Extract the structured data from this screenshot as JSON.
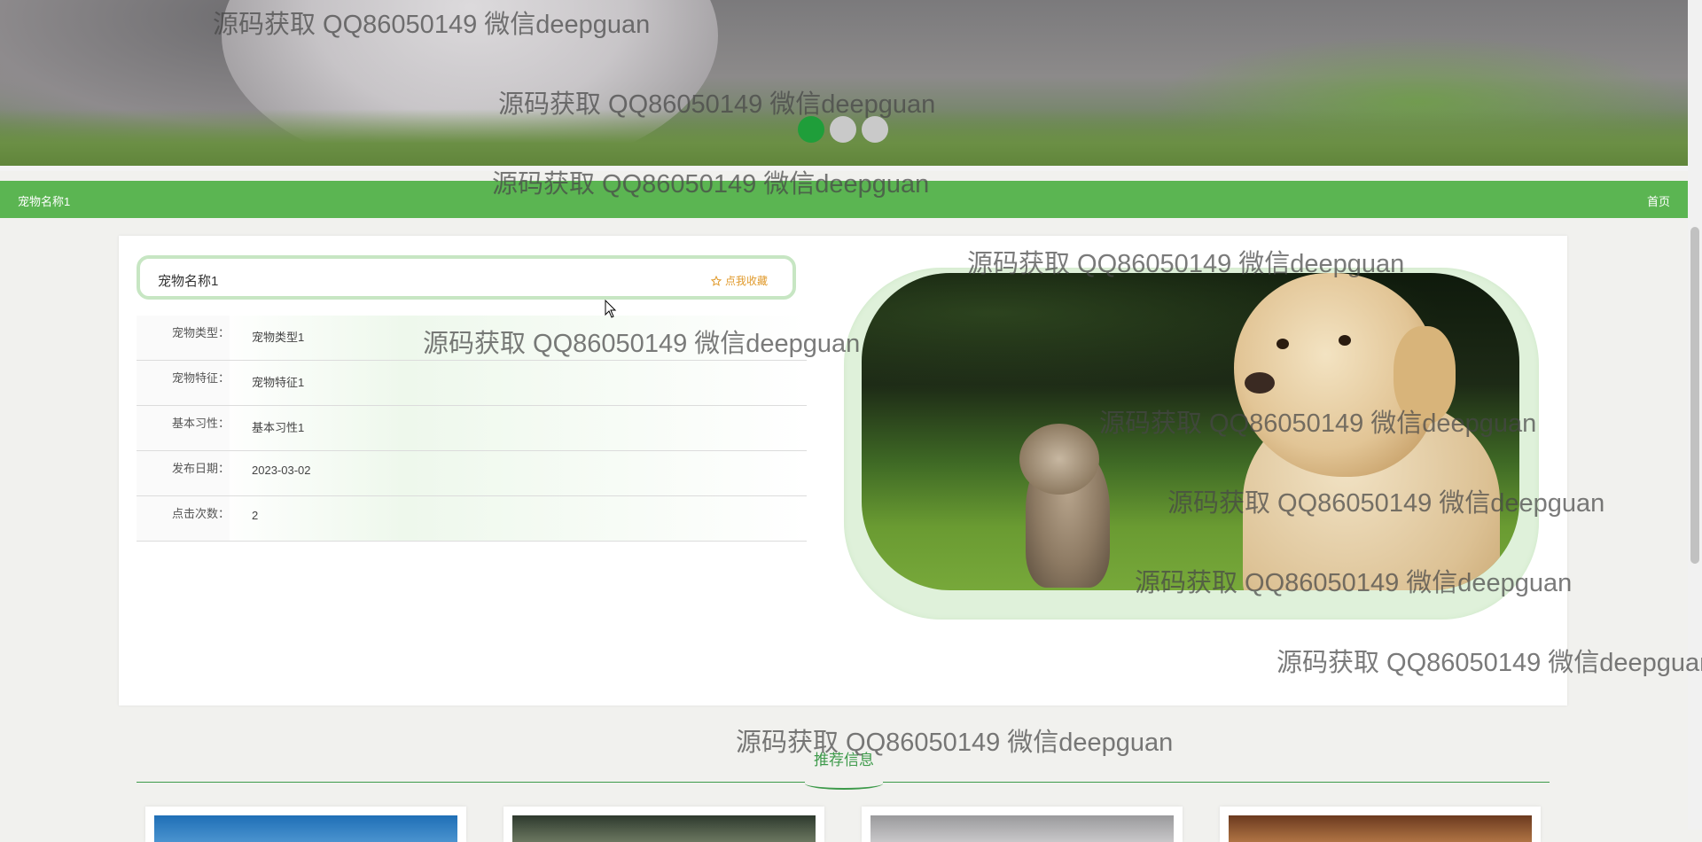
{
  "banner": {
    "slides": 3,
    "active_slide": 0,
    "dot_colors": {
      "active": "#1f9e3a",
      "inactive": "#c9c9c9"
    }
  },
  "navbar": {
    "breadcrumb": "宠物名称1",
    "home": "首页",
    "color": "#5bb552"
  },
  "detail": {
    "title": "宠物名称1",
    "favorite_label": "点我收藏",
    "favorite_icon": "star-outline-icon",
    "fields": [
      {
        "label": "宠物类型：",
        "value": "宠物类型1"
      },
      {
        "label": "宠物特征：",
        "value": "宠物特征1"
      },
      {
        "label": "基本习性：",
        "value": "基本习性1"
      },
      {
        "label": "发布日期：",
        "value": "2023-03-02"
      },
      {
        "label": "点击次数：",
        "value": "2"
      }
    ]
  },
  "recommend": {
    "title": "推荐信息",
    "cards": 4
  },
  "watermark": "源码获取 QQ86050149 微信deepguan"
}
